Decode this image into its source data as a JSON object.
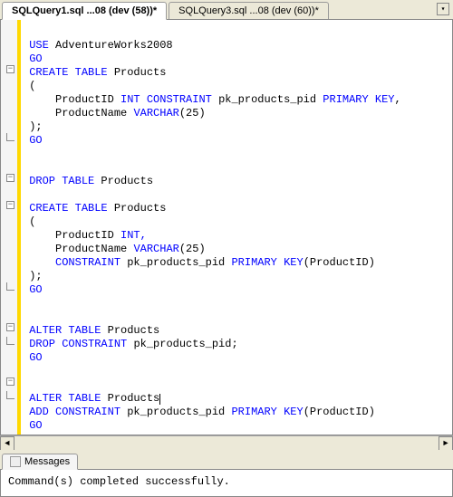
{
  "tabs": {
    "active": "SQLQuery1.sql ...08 (dev (58))*",
    "other": "SQLQuery3.sql ...08 (dev (60))*"
  },
  "sql": {
    "use": "USE",
    "adventure": "AdventureWorks2008",
    "go": "GO",
    "create_table": "CREATE TABLE",
    "products": "Products",
    "lparen": "(",
    "rparen": ");",
    "rparen2": ")",
    "productid": "ProductID",
    "int": "INT",
    "constraint": "CONSTRAINT",
    "pkname": "pk_products_pid",
    "primary_key": "PRIMARY KEY",
    "comma": ",",
    "productname": "ProductName",
    "varchar": "VARCHAR",
    "v25": "(25)",
    "drop_table": "DROP TABLE",
    "intc": "INT,",
    "pk_call": "(ProductID)",
    "alter_table": "ALTER TABLE",
    "drop_constraint": "DROP CONSTRAINT",
    "semi": ";",
    "add_constraint": "ADD CONSTRAINT"
  },
  "messages": {
    "tab": "Messages",
    "text": "Command(s) completed successfully."
  }
}
